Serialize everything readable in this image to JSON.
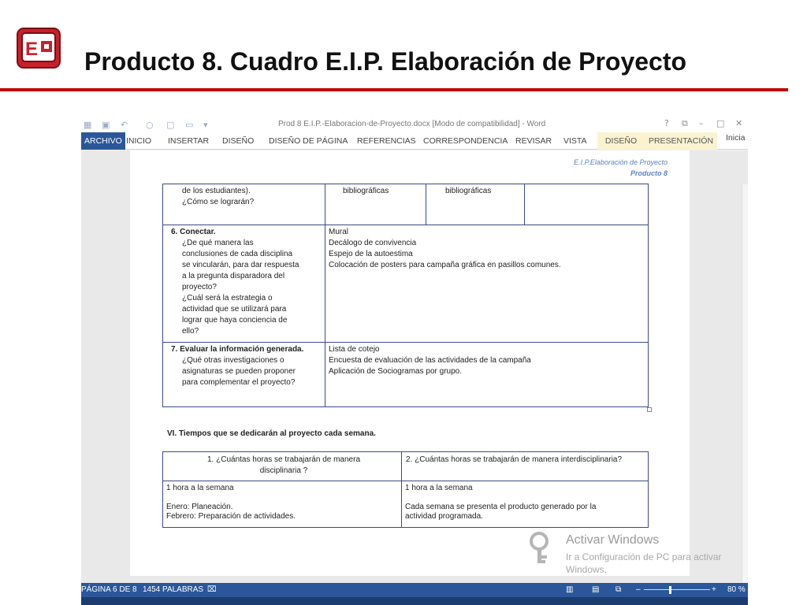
{
  "slide": {
    "title": "Producto 8. Cuadro E.I.P. Elaboración de Proyecto",
    "colors": {
      "accent_rule": "#c00000",
      "word_blue": "#2b579a"
    }
  },
  "word": {
    "window_title": "Prod 8 E.I.P.-Elaboracion-de-Proyecto.docx [Modo de compatibilidad] - Word",
    "window_buttons": [
      "?",
      "⧉",
      "–",
      "□",
      "✕"
    ],
    "ribbon_tabs": [
      "ARCHIVO",
      "INICIO",
      "INSERTAR",
      "DISEÑO",
      "DISEÑO DE PÁGINA",
      "REFERENCIAS",
      "CORRESPONDENCIA",
      "REVISAR",
      "VISTA",
      "DISEÑO",
      "PRESENTACIÓN"
    ],
    "account": "Inicia",
    "page_header": {
      "line1": "E.I.P.Elaboración de Proyecto",
      "line2": "Producto 8"
    },
    "table1": {
      "row0": [
        "de los estudiantes).\n¿Cómo se lograrán?",
        "bibliográficas",
        "bibliográficas",
        ""
      ],
      "row1": {
        "heading": "6. Conectar.",
        "question": "¿De qué manera  las\nconclusiones de cada disciplina\nse vincularán, para dar respuesta\na  la pregunta disparadora del\nproyecto?\n¿Cuál será la   estrategia o\nactividad  que se utilizará para\nlograr que haya conciencia de\nello?",
        "answer": "Mural\nDecálogo de convivencia\nEspejo de la autoestima\nColocación de posters para campaña gráfica en pasillos comunes."
      },
      "row2": {
        "heading": "7. Evaluar la información generada.",
        "question": "¿Qué otras investigaciones o\nasignaturas se pueden  proponer\npara complementar el proyecto?",
        "answer": "Lista de cotejo\nEncuesta de evaluación de las actividades de la campaña\nAplicación de Sociogramas por grupo."
      }
    },
    "section_heading": "VI. Tiempos que se dedicarán al proyecto cada semana.",
    "table2": {
      "col1_header": "1.   ¿Cuántas horas se trabajarán de manera\ndisciplinaria ?",
      "col2_header": "2.  ¿Cuántas horas se trabajarán de manera interdisciplinaria?",
      "col1_body": "1 hora a la semana\n\nEnero: Planeación.\nFebrero: Preparación de actividades.",
      "col2_body": "1 hora a la semana\n\nCada semana se presenta el producto generado por la\nactividad programada."
    },
    "watermark": {
      "title": "Activar Windows",
      "subtitle": "Ir a Configuración de PC para activar\nWindows."
    },
    "status_bar": {
      "page": "PÁGINA 6 DE 8",
      "words": "1454 PALABRAS",
      "zoom": "80 %"
    }
  }
}
